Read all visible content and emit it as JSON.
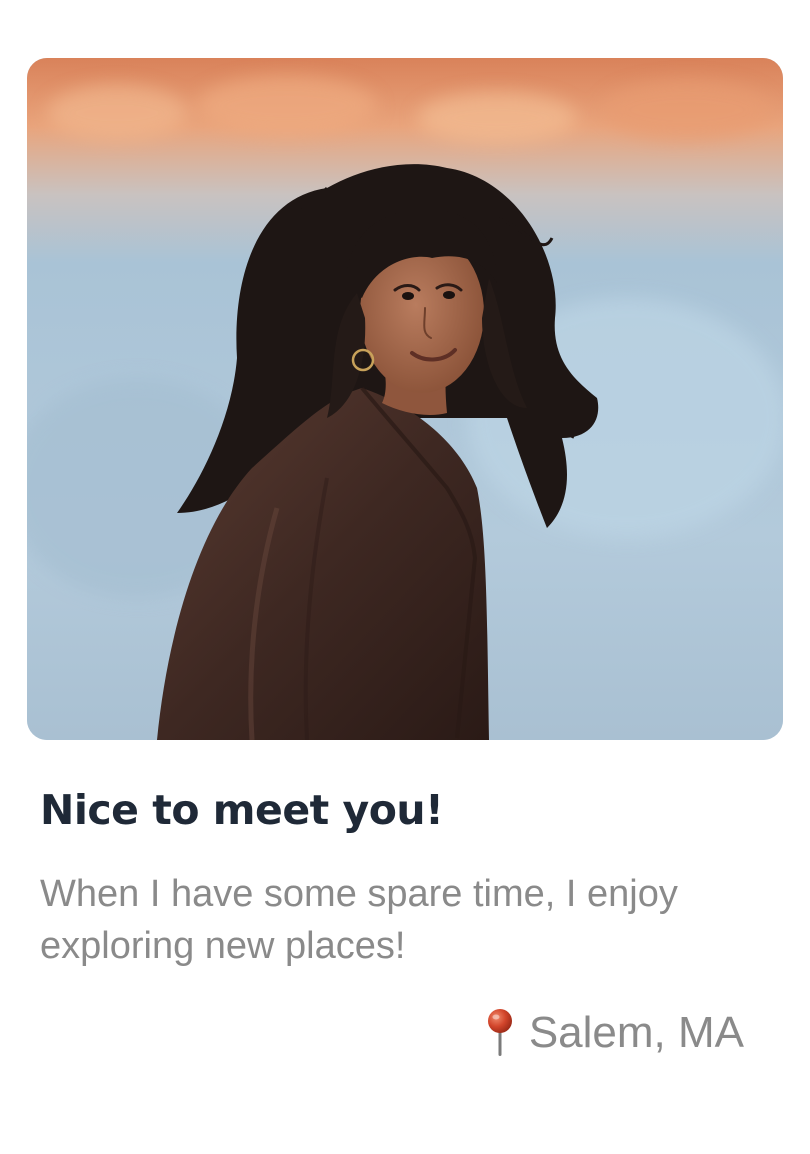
{
  "profile": {
    "title": "Nice to meet you!",
    "bio": "When I have some spare time, I enjoy exploring new places!",
    "location": "Salem, MA"
  },
  "icons": {
    "location": "pushpin-icon"
  },
  "colors": {
    "title": "#1f2937",
    "body_text": "#8a8a8a",
    "pin_head": "#d2452b",
    "background": "#ffffff"
  }
}
